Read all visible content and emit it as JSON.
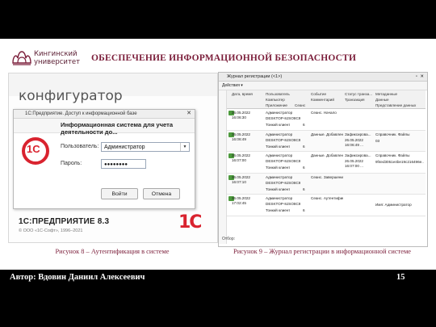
{
  "header": {
    "logo_line1": "Кингинский",
    "logo_line2": "университет",
    "title": "ОБЕСПЕЧЕНИЕ ИНФОРМАЦИОННОЙ БЕЗОПАСНОСТИ"
  },
  "left_screenshot": {
    "banner_text": "конфигуратор",
    "dialog": {
      "title": "1С:Предприятие. Доступ к информационной базе",
      "heading": "Информационная система для учета деятельности до...",
      "user_label": "Пользователь:",
      "user_value": "Администратор",
      "password_label": "Пароль:",
      "password_value": "●●●●●●●●",
      "ok_label": "Войти",
      "cancel_label": "Отмена",
      "logo_text": "1С"
    },
    "product": "1С:ПРЕДПРИЯТИЕ 8.3",
    "copyright": "© ООО «1С-Софт», 1996–2021",
    "mark_text": "1С"
  },
  "left_caption": "Рисунок 8 – Аутентификация в системе",
  "right_screenshot": {
    "window_title": "Журнал регистрации (<1>)",
    "toolbar": "Действия ▾",
    "columns": {
      "date": "Дата, время",
      "user": "Пользователь",
      "computer": "Компьютер",
      "app": "Приложение",
      "session": "Сеанс",
      "event": "Событие",
      "comment": "Комментарий",
      "status": "Статус транза...",
      "transaction": "Транзакция",
      "metadata": "Метаданные",
      "data": "Данные",
      "repr": "Представление данных"
    },
    "rows": [
      {
        "date": "26.05.2022",
        "time": "16:06:30",
        "user": "Администратор",
        "computer": "DESKTOP-8JSO8C9",
        "app": "Тонкий клиент",
        "session": "6",
        "event": "Сеанс. Начало",
        "status": "",
        "tx": "",
        "meta": "",
        "data": ""
      },
      {
        "date": "26.05.2022",
        "time": "16:06:49",
        "user": "Администратор",
        "computer": "DESKTOP-8JSO8C9",
        "app": "Тонкий клиент",
        "session": "6",
        "event": "Данные. Добавлен...",
        "status": "Зафиксирова...",
        "tx": "26.05.2022 16:06:49 ...",
        "meta": "Справочник. Файлы",
        "data": "03"
      },
      {
        "date": "26.05.2022",
        "time": "16:07:00",
        "user": "Администратор",
        "computer": "DESKTOP-8JSO8C9",
        "app": "Тонкий клиент",
        "session": "6",
        "event": "Данные. Добавлен...",
        "status": "Зафиксирова...",
        "tx": "26.05.2022 16:07:00 ...",
        "meta": "Справочник. Файлы",
        "data": "9f4ed3051e4be19c216496e..."
      },
      {
        "date": "26.05.2022",
        "time": "16:07:10",
        "user": "Администратор",
        "computer": "DESKTOP-8JSO8C9",
        "app": "Тонкий клиент",
        "session": "6",
        "event": "Сеанс. Завершение",
        "status": "",
        "tx": "",
        "meta": "",
        "data": ""
      },
      {
        "date": "26.05.2022",
        "time": "17:02:45",
        "user": "Администратор",
        "computer": "DESKTOP-8JSO8C9",
        "app": "Тонкий клиент",
        "session": "6",
        "event": "Сеанс. Аутентифика...",
        "status": "",
        "tx": "",
        "meta": "Имя: Администратор",
        "data": ""
      }
    ],
    "filter_label": "Отбор:"
  },
  "right_caption": "Рисунок 9 – Журнал регистрации  в информационной системе",
  "footer": {
    "author": "Автор: Вдовин Даниил Алексеевич",
    "page": "15"
  }
}
